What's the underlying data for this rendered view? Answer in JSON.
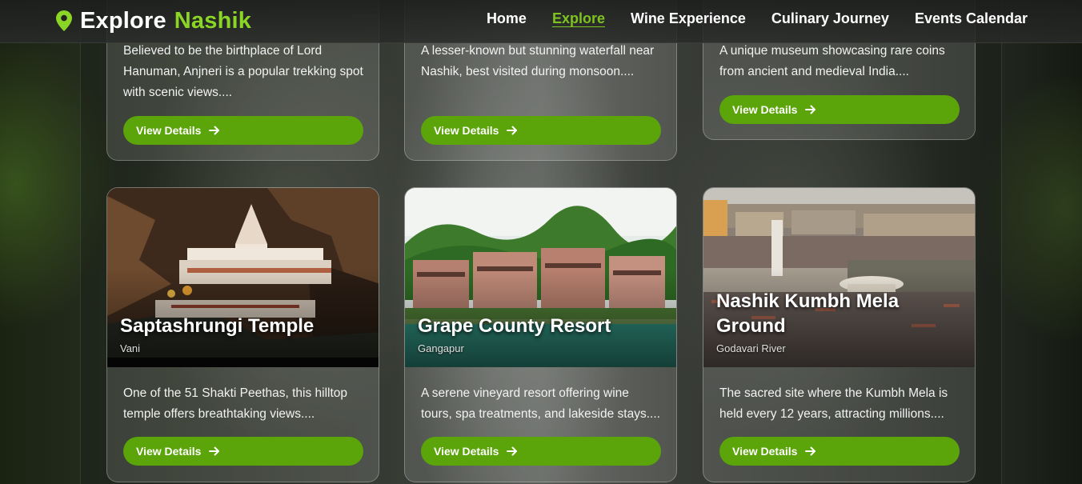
{
  "nav": {
    "brand_prefix": "Explore",
    "brand_accent": "Nashik",
    "links": [
      {
        "label": "Home",
        "active": false
      },
      {
        "label": "Explore",
        "active": true
      },
      {
        "label": "Wine Experience",
        "active": false
      },
      {
        "label": "Culinary Journey",
        "active": false
      },
      {
        "label": "Events Calendar",
        "active": false
      }
    ]
  },
  "colors": {
    "accent": "#8bd526",
    "button": "#5ba409",
    "active_link": "#7ec320"
  },
  "top_cards": [
    {
      "description": "Believed to be the birthplace of Lord Hanuman, Anjneri is a popular trekking spot with scenic views....",
      "button": "View Details"
    },
    {
      "description": "A lesser-known but stunning waterfall near Nashik, best visited during monsoon....",
      "button": "View Details"
    },
    {
      "description": "A unique museum showcasing rare coins from ancient and medieval India....",
      "button": "View Details"
    }
  ],
  "cards": [
    {
      "title": "Saptashrungi Temple",
      "location": "Vani",
      "description": "One of the 51 Shakti Peethas, this hilltop temple offers breathtaking views....",
      "button": "View Details",
      "image": "temple-on-cliff"
    },
    {
      "title": "Grape County Resort",
      "location": "Gangapur",
      "description": "A serene vineyard resort offering wine tours, spa treatments, and lakeside stays....",
      "button": "View Details",
      "image": "resort-by-lake"
    },
    {
      "title": "Nashik Kumbh Mela Ground",
      "location": "Godavari River",
      "description": "The sacred site where the Kumbh Mela is held every 12 years, attracting millions....",
      "button": "View Details",
      "image": "crowded-river-ghat"
    }
  ],
  "icons": {
    "brand": "map-pin-icon",
    "button": "arrow-right-icon"
  }
}
